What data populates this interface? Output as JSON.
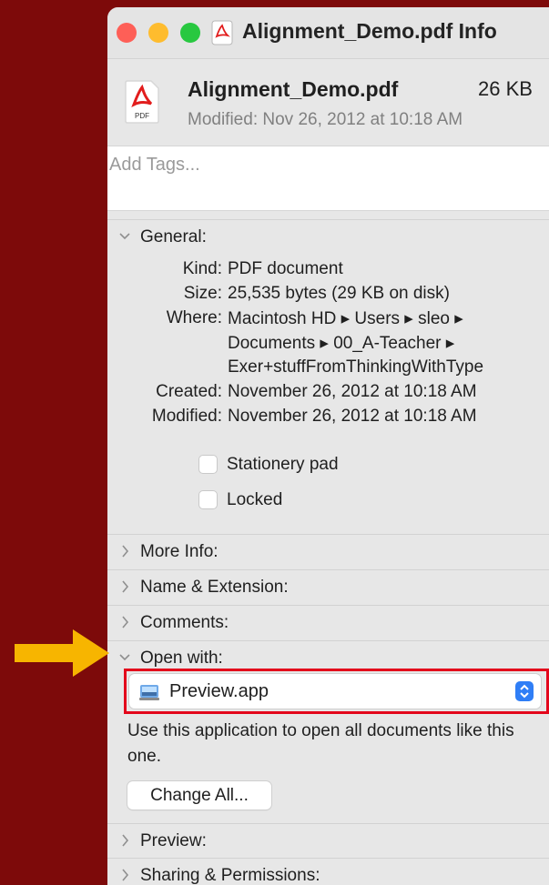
{
  "window": {
    "title": "Alignment_Demo.pdf Info"
  },
  "file": {
    "name": "Alignment_Demo.pdf",
    "size": "26 KB",
    "modified": "Modified: Nov 26, 2012 at 10:18 AM",
    "icon": "pdf-document-icon",
    "icon_text": "PDF"
  },
  "tags": {
    "placeholder": "Add Tags..."
  },
  "general": {
    "header": "General:",
    "rows": [
      {
        "key": "Kind:",
        "value": "PDF document"
      },
      {
        "key": "Size:",
        "value": "25,535 bytes (29 KB on disk)"
      },
      {
        "key": "Where:",
        "value": "Macintosh HD ▸ Users ▸ sleo ▸"
      },
      {
        "key": "",
        "value": "Documents ▸ 00_A-Teacher ▸"
      },
      {
        "key": "",
        "value": "Exer+stuffFromThinkingWithType"
      },
      {
        "key": "Created:",
        "value": "November 26, 2012 at 10:18 AM"
      },
      {
        "key": "Modified:",
        "value": "November 26, 2012 at 10:18 AM"
      }
    ],
    "stationery_pad": "Stationery pad",
    "locked": "Locked"
  },
  "sections": {
    "more_info": "More Info:",
    "name_extension": "Name & Extension:",
    "comments": "Comments:",
    "open_with": "Open with:",
    "preview": "Preview:",
    "sharing": "Sharing & Permissions:"
  },
  "open_with": {
    "app": "Preview.app",
    "description": "Use this application to open all documents like this one.",
    "change_all": "Change All..."
  },
  "colors": {
    "background": "#7d0a0a",
    "arrow": "#f7b500",
    "highlight": "#e3061b",
    "accent": "#2f7ef6"
  }
}
